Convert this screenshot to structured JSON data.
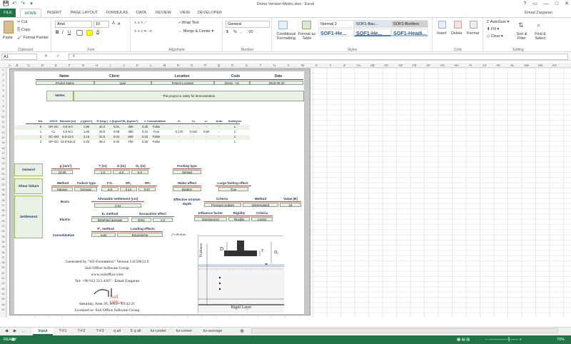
{
  "window": {
    "title": "Demo Version-Metric.xlsx - Excel",
    "controls": [
      "?",
      "▭",
      "—",
      "□",
      "✕"
    ]
  },
  "qat": [
    "💾",
    "↶",
    "↷",
    "▾"
  ],
  "ribbon_tabs": [
    "FILE",
    "HOME",
    "INSERT",
    "PAGE LAYOUT",
    "FORMULAS",
    "DATA",
    "REVIEW",
    "VIEW",
    "DEVELOPER"
  ],
  "user": "Emad Zargaran",
  "clipboard": {
    "paste": "Paste",
    "cut": "Cut",
    "copy": "Copy",
    "painter": "Format Painter",
    "label": "Clipboard"
  },
  "font": {
    "name": "Arial",
    "size": "10",
    "label": "Font",
    "bold": "B",
    "italic": "I",
    "underline": "U",
    "grow": "A",
    "shrink": "A",
    "color": "A"
  },
  "alignment": {
    "wrap": "Wrap Text",
    "merge": "Merge & Center",
    "label": "Alignment"
  },
  "number": {
    "format": "General",
    "label": "Number",
    "currency": "$",
    "percent": "%",
    "comma": ",",
    "inc_dec": ".00"
  },
  "styles": {
    "conditional": "Conditional Formatting",
    "format_table": "Format as Table",
    "label": "Styles",
    "cells": [
      "Normal 2",
      "SOF1-Bac...",
      "SOF1-Borders",
      "SOF1-He...",
      "SOF1-He...",
      "SOF1-Headi..."
    ]
  },
  "cells_grp": {
    "insert": "Insert",
    "delete": "Delete",
    "format": "Format",
    "label": "Cells"
  },
  "editing": {
    "autosum": "AutoSum",
    "fill": "Fill",
    "clear": "Clear",
    "sort": "Sort & Filter",
    "find": "Find & Select",
    "label": "Editing"
  },
  "formula_bar": {
    "cell": "A1",
    "buttons": "✕ ✓ fx",
    "value": ""
  },
  "columns": [
    "A",
    "B",
    "C",
    "D",
    "E",
    "F",
    "G",
    "H",
    "I",
    "J",
    "K",
    "L",
    "M",
    "N",
    "O",
    "P",
    "Q",
    "R",
    "S",
    "T",
    "U",
    "V",
    "W",
    "X",
    "Y",
    "Z",
    "AA",
    "AB",
    "AC",
    "AD",
    "AE",
    "AF",
    "AG",
    "AH",
    "AI",
    "AJ",
    "AK",
    "AL",
    "AM",
    "AN",
    "AO"
  ],
  "project": {
    "headers": [
      "Name",
      "Client",
      "Location",
      "Code",
      "Date"
    ],
    "values": [
      "Project Name",
      "User",
      "Project Location",
      "Demo - 01",
      "2015-06-20"
    ],
    "notes_label": "Notes",
    "notes": "This project is solely for demonstration"
  },
  "soil_table": {
    "headers": [
      "No.",
      "USCS",
      "Bounds [m]",
      "γ [g/cm³]",
      "Φ [deg.]",
      "c [kg/cm²]",
      "Eₛ [kg/cm²]",
      "ν",
      "Consolidation",
      "Cᵣ",
      "Cₑ",
      "e₀",
      "Auto",
      "Sublayers"
    ],
    "rows": [
      [
        "0",
        "GP-GC",
        "0.0-6.0",
        "1.80",
        "32.2",
        "0.01",
        "450",
        "0.30",
        "False",
        "-",
        "-",
        "-",
        "-",
        "1"
      ],
      [
        "1",
        "CL",
        "6.0-8.0",
        "1.65",
        "26.0",
        "0.08",
        "350",
        "0.41",
        "True",
        "0.170",
        "0.024",
        "0.50",
        "-",
        "2"
      ],
      [
        "2",
        "SC-SM",
        "8.0-13.0",
        "2.15",
        "31.5",
        "0.04",
        "500",
        "0.33",
        "False",
        "-",
        "-",
        "-",
        "-",
        "1"
      ],
      [
        "3",
        "GP-GC",
        "13.0-515.0",
        "2.20",
        "35.4",
        "0.03",
        "700",
        "0.30",
        "False",
        "-",
        "-",
        "-",
        "-",
        "1"
      ]
    ]
  },
  "general": {
    "label": "General",
    "g_label": "g [m/s²]",
    "g": "10.00",
    "T_label": "T [m]",
    "T": "1.0",
    "D_label": "D [m]",
    "D": "4.0",
    "Dw_label": "Dᵤ [m]",
    "Dw": "6.0",
    "ftype_label": "Footing type",
    "ftype": "Spread"
  },
  "shear": {
    "label": "Shear failure",
    "method_label": "Method",
    "method": "Hansen",
    "ftype_label": "Failure type",
    "ftype": "General",
    "fs_label": "F.S.",
    "fs": "4.0",
    "rfc_label": "RF꜀",
    "rfc": "0.14",
    "rfs_label": "RFₛ",
    "rfs": "0.67",
    "water_label": "Water effect",
    "water": "Bowles",
    "large_label": "Large footing effect",
    "large": "True"
  },
  "settlement": {
    "label": "Settlement",
    "basic": "Basic",
    "elastic": "Elastic",
    "consol": "Consolidation",
    "allow_label": "Allowable settlement [cm]",
    "allow": "2.54",
    "eff_label": "Effective stratum depth",
    "criteria_label": "Criteria",
    "criteria": "Pressure isobars",
    "method_label": "Method",
    "method": "Westergaard",
    "value_label": "Value [B]",
    "value": "10",
    "es_label": "Eₛ method",
    "es": "Weighted average",
    "exc_label": "Excavation effect",
    "exc_a": "ErEs",
    "exc_b": "1.0",
    "inf_label": "Influence factor",
    "inf": "Steinbrenner",
    "rig_label": "Rigidity",
    "rig": "Flexible",
    "crit_label": "Criteria",
    "crit": "Center",
    "pc_label": "P'꜀ method",
    "pc": "Auto",
    "load_label": "Loading effects",
    "load": "Boussinesq",
    "load2": "(T+4Pt+B)/6"
  },
  "generated": {
    "l1": "Generated by \"SO-Foundation\" Version 2.0.50612.0",
    "l2": "Soil Office Software Group",
    "l3": "www.soiloffice.com",
    "l4": "Tel: +98 912 313 4107 - Emad Zargaran",
    "logo": "Soil Office",
    "date": "Saturday, June 20, 2015 - 19:42:21",
    "lic": "Licensed to: Soil Office Software Group"
  },
  "figure": {
    "thickness": "Thickness",
    "D": "D",
    "T": "T",
    "Dw": "Dᵤ",
    "rigid": "Rigid Layer"
  },
  "sheets": [
    "Input",
    "T-F1",
    "T-F2",
    "T-F3",
    "q all",
    "S q all",
    "ks-center",
    "ks-corner",
    "ks-average"
  ],
  "status": {
    "state": "READY",
    "zoom": "70%"
  },
  "row_numbers": [
    "1",
    "2",
    "3",
    "4",
    "5",
    "6",
    "7",
    "8",
    "9",
    "10",
    "11",
    "12",
    "13",
    "14",
    "15",
    "16",
    "17",
    "18",
    "19",
    "20",
    "21",
    "22",
    "23",
    "24",
    "25",
    "26",
    "27",
    "28",
    "29",
    "30",
    "31",
    "32",
    "33",
    "34",
    "35",
    "36",
    "37",
    "38",
    "39",
    "40",
    "41",
    "42",
    "43",
    "44",
    "45",
    "46",
    "47"
  ]
}
